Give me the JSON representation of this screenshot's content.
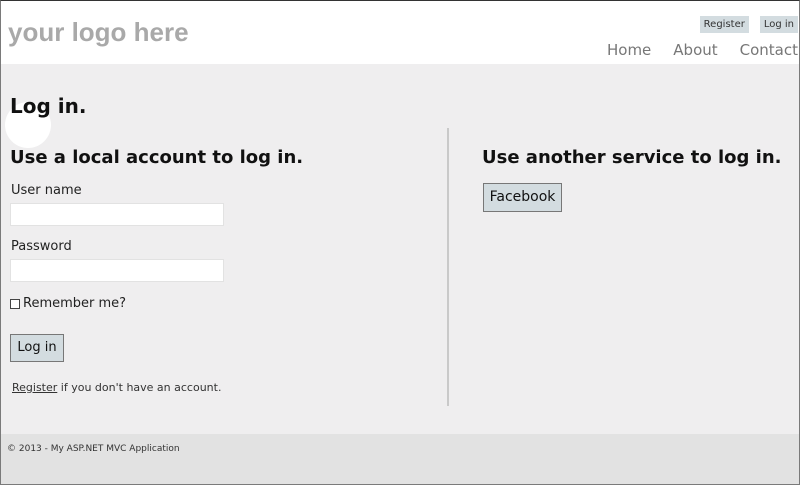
{
  "header": {
    "logo": "your logo here",
    "login_links": {
      "register": "Register",
      "login": "Log in"
    },
    "menu": [
      {
        "label": "Home"
      },
      {
        "label": "About"
      },
      {
        "label": "Contact"
      }
    ]
  },
  "main": {
    "title": "Log in.",
    "local": {
      "heading": "Use a local account to log in.",
      "username_label": "User name",
      "username_value": "",
      "password_label": "Password",
      "password_value": "",
      "remember_label": "Remember me?",
      "remember_checked": false,
      "submit_label": "Log in",
      "register_link": "Register",
      "register_suffix": " if you don't have an account."
    },
    "external": {
      "heading": "Use another service to log in.",
      "facebook_label": "Facebook"
    }
  },
  "footer": {
    "text": "© 2013 - My ASP.NET MVC Application"
  }
}
